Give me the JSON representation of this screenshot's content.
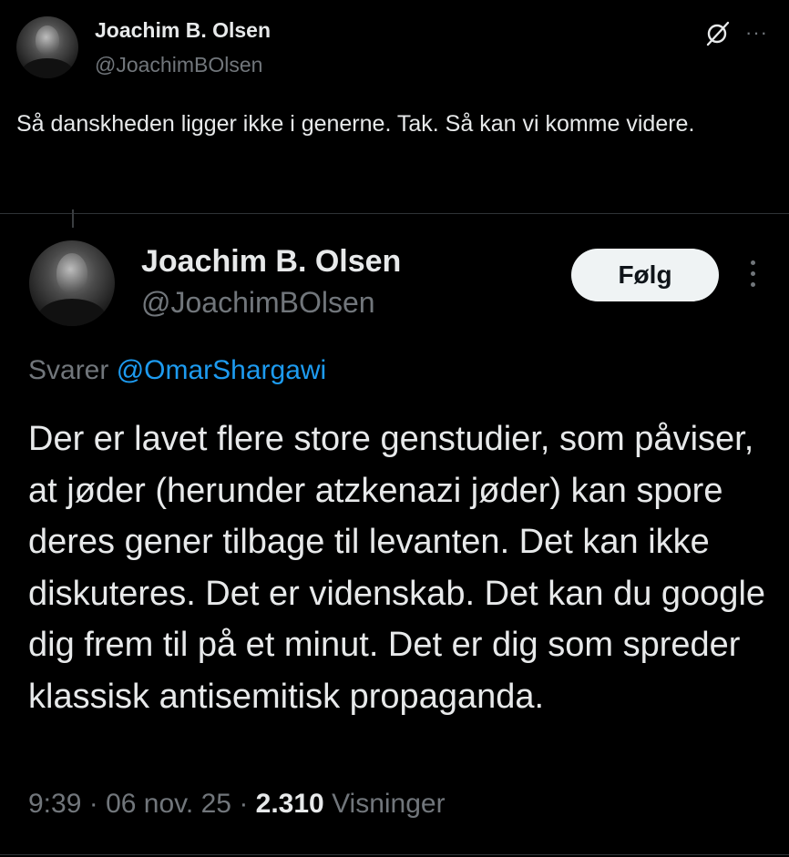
{
  "top_tweet": {
    "name": "Joachim B. Olsen",
    "handle": "@JoachimBOlsen",
    "text": "Så danskheden ligger ikke i generne. Tak. Så kan vi komme videre.",
    "icons": [
      "grok-icon",
      "more-icon"
    ]
  },
  "quoted_tweet": {
    "name": "Joachim B. Olsen",
    "handle": "@JoachimBOlsen",
    "follow_label": "Følg",
    "reply_prefix": "Svarer",
    "reply_mention": "@OmarShargawi",
    "text": "Der er lavet flere store genstudier, som påviser, at jøder (herunder atzkenazi jøder) kan spore deres gener tilbage til levanten. Det kan ikke diskuteres. Det er videnskab. Det kan du google dig frem til på et minut. Det er dig som spreder klassisk antisemitisk propaganda.",
    "time": "9:39",
    "date": "06 nov. 25",
    "views_count": "2.310",
    "views_label": "Visninger",
    "separator": "·"
  },
  "colors": {
    "background": "#000000",
    "text": "#e7e9ea",
    "secondary": "#71767b",
    "link": "#1d9bf0",
    "button_bg": "#eff3f4"
  }
}
